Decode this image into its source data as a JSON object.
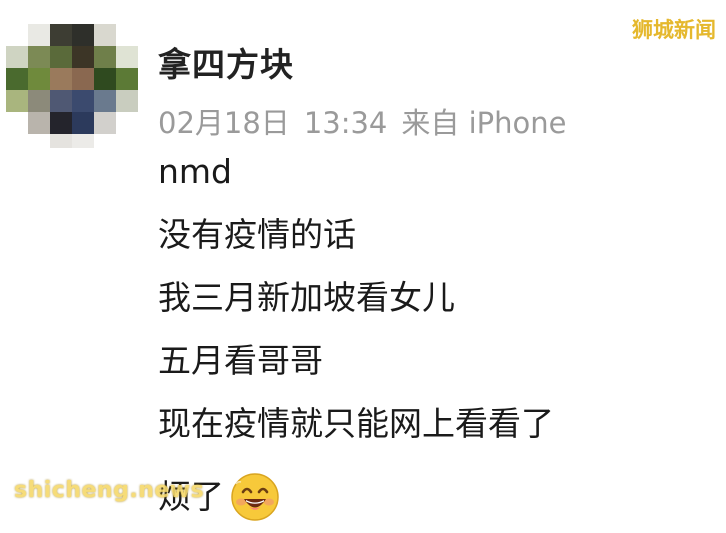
{
  "post": {
    "username": "拿四方块",
    "date": "02月18日",
    "time": "13:34",
    "source": "来自 iPhone",
    "lines": [
      "nmd",
      "没有疫情的话",
      "我三月新加坡看女儿",
      "五月看哥哥",
      "现在疫情就只能网上看看了",
      "烦了"
    ],
    "trailing_emoji": "grinning-face-emoji"
  },
  "watermarks": {
    "top_right": "狮城新闻",
    "bottom_left": "shicheng.news"
  },
  "colors": {
    "username": "#222222",
    "meta": "#9a9a9a",
    "body_text": "#1a1a1a",
    "watermark_top": "#e5b82d",
    "watermark_bottom": "#f6d96b"
  }
}
